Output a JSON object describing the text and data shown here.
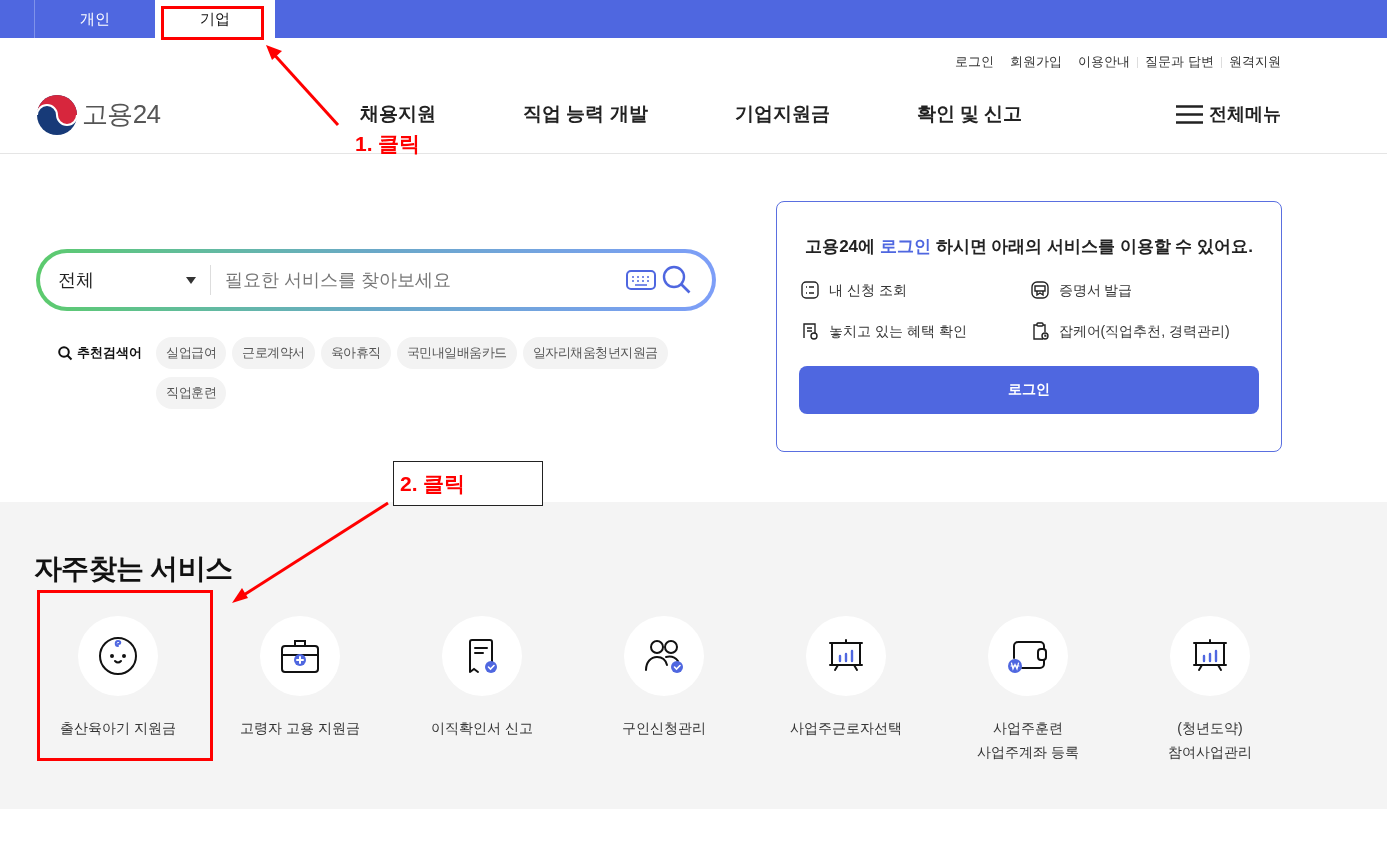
{
  "top_tabs": [
    {
      "label": "개인",
      "selected": false
    },
    {
      "label": "기업",
      "selected": true
    }
  ],
  "utility_links": [
    "로그인",
    "회원가입",
    "이용안내",
    "질문과 답변",
    "원격지원"
  ],
  "logo": {
    "text": "고용24"
  },
  "nav": [
    "채용지원",
    "직업 능력 개발",
    "기업지원금",
    "확인 및 신고"
  ],
  "menu_button": "전체메뉴",
  "search": {
    "category": "전체",
    "placeholder": "필요한 서비스를 찾아보세요"
  },
  "recommended": {
    "label": "추천검색어",
    "keywords": [
      "실업급여",
      "근로계약서",
      "육아휴직",
      "국민내일배움카드",
      "일자리채움청년지원금",
      "직업훈련"
    ]
  },
  "login_card": {
    "before": "고용24에",
    "highlight": "로그인",
    "after": "하시면 아래의 서비스를 이용할 수 있어요.",
    "items": [
      "내 신청 조회",
      "증명서 발급",
      "놓치고 있는 혜택 확인",
      "잡케어(직업추천, 경력관리)"
    ],
    "button": "로그인"
  },
  "services": {
    "title": "자주찾는 서비스",
    "items": [
      {
        "lines": [
          "출산육아기 지원금"
        ]
      },
      {
        "lines": [
          "고령자 고용 지원금"
        ]
      },
      {
        "lines": [
          "이직확인서 신고"
        ]
      },
      {
        "lines": [
          "구인신청관리"
        ]
      },
      {
        "lines": [
          "사업주근로자선택"
        ]
      },
      {
        "lines": [
          "사업주훈련",
          "사업주계좌 등록"
        ]
      },
      {
        "lines": [
          "(청년도약)",
          "참여사업관리"
        ]
      }
    ]
  },
  "annotations": [
    {
      "kind": "plain",
      "text": "1. 클릭"
    },
    {
      "kind": "boxed",
      "text": "2. 클릭"
    }
  ]
}
